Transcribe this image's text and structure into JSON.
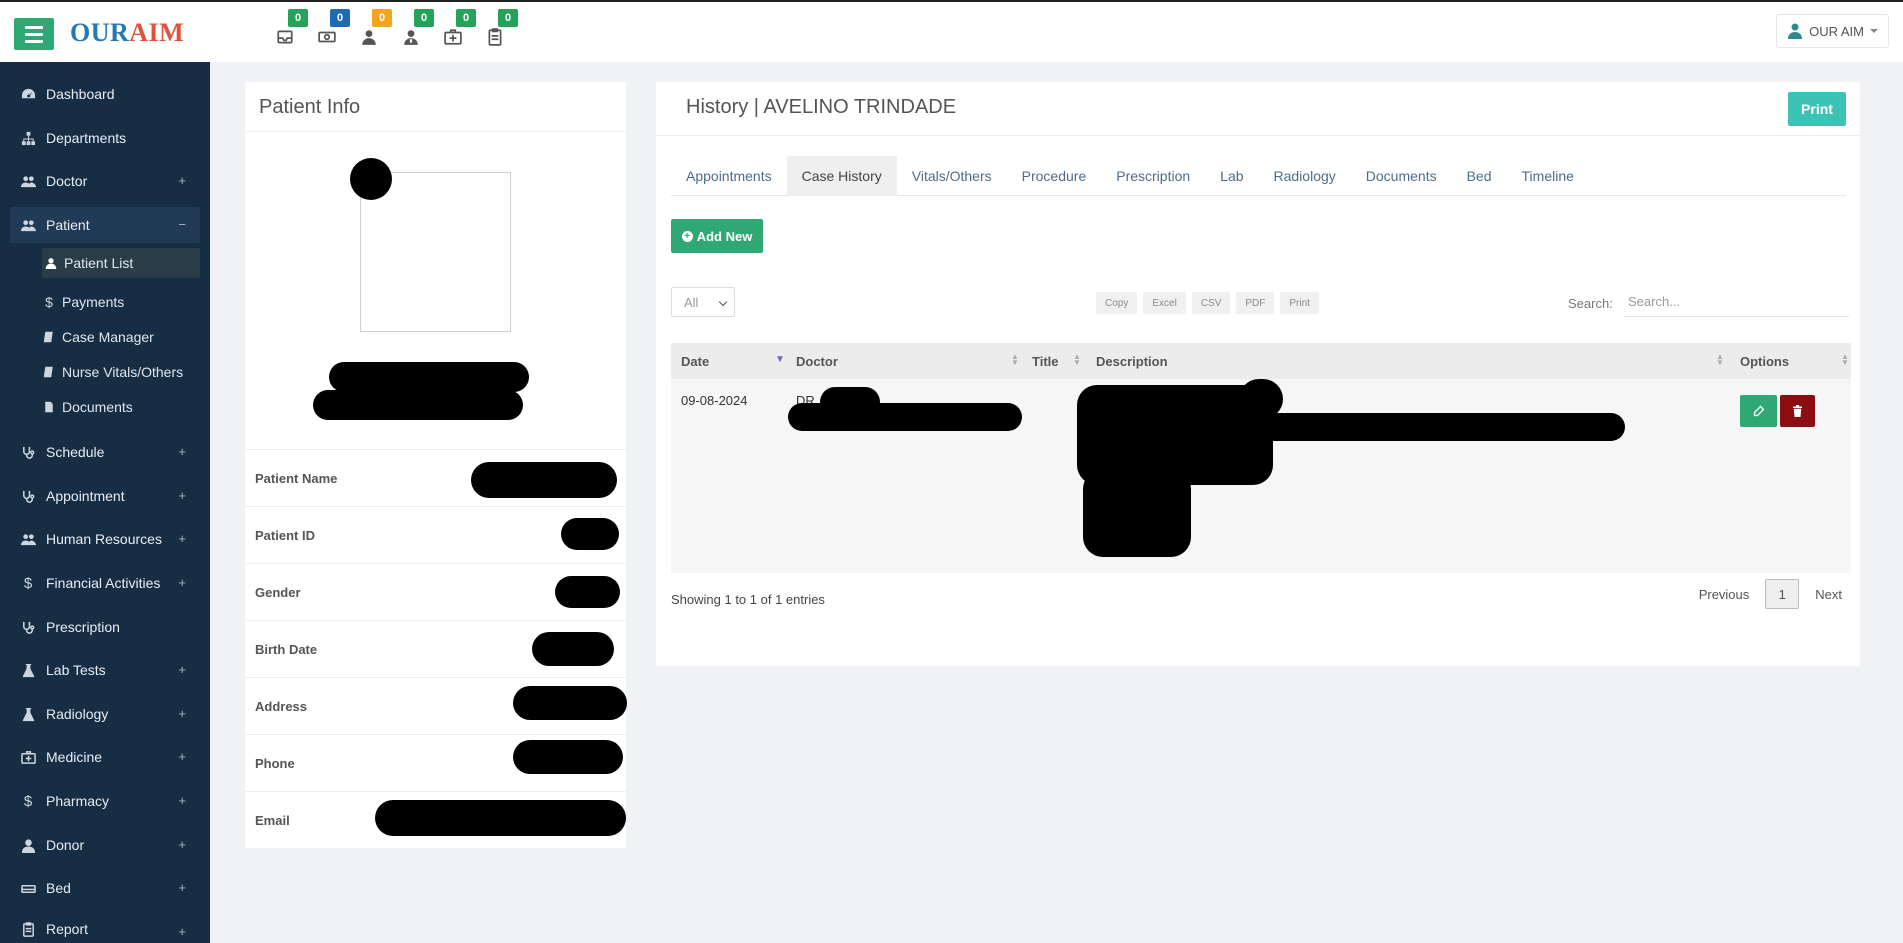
{
  "app": {
    "logo_part1": "OUR",
    "logo_part2": "AIM",
    "user_name": "OUR AIM",
    "badge_colors": [
      "#26a35b",
      "#1f6cb5",
      "#f3a51b",
      "#26a35b",
      "#26a35b",
      "#26a35b"
    ],
    "notifications": [
      {
        "icon": "inbox-icon",
        "count": "0"
      },
      {
        "icon": "money-icon",
        "count": "0"
      },
      {
        "icon": "user-icon",
        "count": "0"
      },
      {
        "icon": "user-doctor-icon",
        "count": "0"
      },
      {
        "icon": "medkit-icon",
        "count": "0"
      },
      {
        "icon": "clipboard-icon",
        "count": "0"
      }
    ]
  },
  "sidebar": {
    "items": [
      {
        "label": "Dashboard",
        "icon": "dashboard-icon",
        "has_plus": false
      },
      {
        "label": "Departments",
        "icon": "sitemap-icon",
        "has_plus": false
      },
      {
        "label": "Doctor",
        "icon": "users-icon",
        "has_plus": true
      },
      {
        "label": "Patient",
        "icon": "users-icon",
        "has_plus": true,
        "expanded": true
      },
      {
        "label": "Schedule",
        "icon": "stethoscope-icon",
        "has_plus": true
      },
      {
        "label": "Appointment",
        "icon": "stethoscope-icon",
        "has_plus": true
      },
      {
        "label": "Human Resources",
        "icon": "users-icon",
        "has_plus": true
      },
      {
        "label": "Financial Activities",
        "icon": "dollar-icon",
        "has_plus": true
      },
      {
        "label": "Prescription",
        "icon": "stethoscope-icon",
        "has_plus": false
      },
      {
        "label": "Lab Tests",
        "icon": "flask-icon",
        "has_plus": true
      },
      {
        "label": "Radiology",
        "icon": "flask-icon",
        "has_plus": true
      },
      {
        "label": "Medicine",
        "icon": "medkit-icon",
        "has_plus": true
      },
      {
        "label": "Pharmacy",
        "icon": "dollar-icon",
        "has_plus": true
      },
      {
        "label": "Donor",
        "icon": "user-icon",
        "has_plus": true
      },
      {
        "label": "Bed",
        "icon": "bed-icon",
        "has_plus": true
      },
      {
        "label": "Report",
        "icon": "report-icon",
        "has_plus": true
      }
    ],
    "plus_symbol": "+",
    "minus_symbol": "−",
    "patient_sub": [
      {
        "label": "Patient List",
        "icon": "user-icon",
        "active": true
      },
      {
        "label": "Payments",
        "icon": "dollar-icon"
      },
      {
        "label": "Case Manager",
        "icon": "book-icon"
      },
      {
        "label": "Nurse Vitals/Others",
        "icon": "book-icon"
      },
      {
        "label": "Documents",
        "icon": "file-icon"
      }
    ]
  },
  "patient_info": {
    "title": "Patient Info",
    "fields": [
      "Patient Name",
      "Patient ID",
      "Gender",
      "Birth Date",
      "Address",
      "Phone",
      "Email"
    ]
  },
  "history": {
    "title": "History | AVELINO TRINDADE",
    "print_label": "Print",
    "tabs": [
      "Appointments",
      "Case History",
      "Vitals/Others",
      "Procedure",
      "Prescription",
      "Lab",
      "Radiology",
      "Documents",
      "Bed",
      "Timeline"
    ],
    "active_tab": 1,
    "add_new_label": "Add New",
    "length_option": "All",
    "export_buttons": [
      "Copy",
      "Excel",
      "CSV",
      "PDF",
      "Print"
    ],
    "search_label": "Search:",
    "search_placeholder": "Search...",
    "columns": [
      "Date",
      "Doctor",
      "Title",
      "Description",
      "Options"
    ],
    "rows": [
      {
        "date": "09-08-2024",
        "doctor": "DR"
      }
    ],
    "showing_text": "Showing 1 to 1 of 1 entries",
    "pager": {
      "previous": "Previous",
      "page": "1",
      "next": "Next"
    }
  },
  "colors": {
    "sidebar_bg": "#172d44",
    "accent_green": "#2fa874",
    "print_teal": "#3cc3b6",
    "delete_red": "#8a0d12"
  }
}
